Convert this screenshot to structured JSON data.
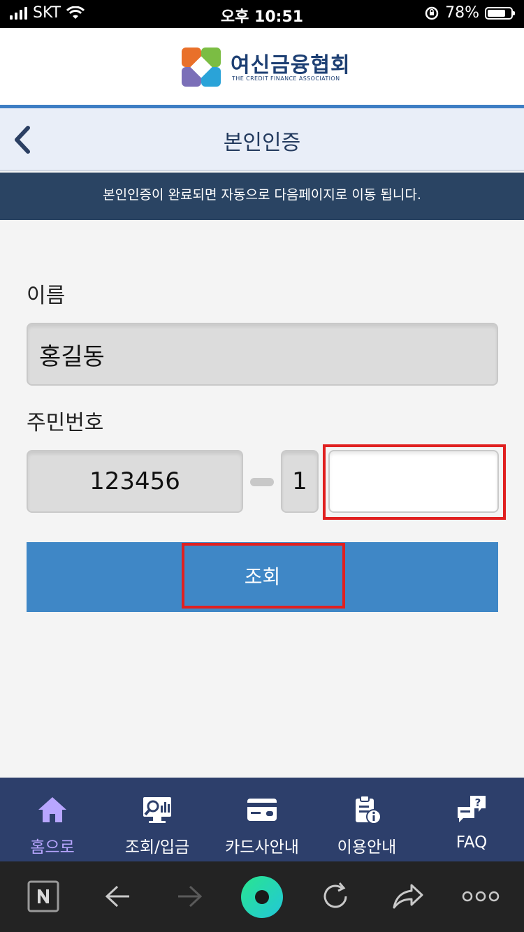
{
  "status_bar": {
    "carrier": "SKT",
    "time": "오후 10:51",
    "battery": "78%",
    "battery_level": 0.78
  },
  "header": {
    "logo_ko": "여신금융협회",
    "logo_en": "THE CREDIT FINANCE ASSOCIATION"
  },
  "nav": {
    "title": "본인인증"
  },
  "notice": "본인인증이 완료되면 자동으로 다음페이지로 이동 됩니다.",
  "form": {
    "name_label": "이름",
    "name_value": "홍길동",
    "rrn_label": "주민번호",
    "rrn_front": "123456",
    "rrn_back_first": "1",
    "rrn_back_rest": "",
    "submit_label": "조회"
  },
  "tabs": [
    {
      "label": "홈으로",
      "icon": "home-icon",
      "active": true
    },
    {
      "label": "조회/입금",
      "icon": "search-chart-icon",
      "active": false
    },
    {
      "label": "카드사안내",
      "icon": "card-icon",
      "active": false
    },
    {
      "label": "이용안내",
      "icon": "clipboard-info-icon",
      "active": false
    },
    {
      "label": "FAQ",
      "icon": "faq-chat-icon",
      "active": false
    }
  ],
  "colors": {
    "accent_blue": "#3f87c6",
    "navy": "#2d3f6b",
    "highlight_red": "#e02020",
    "active_tab": "#b8a6ff"
  }
}
